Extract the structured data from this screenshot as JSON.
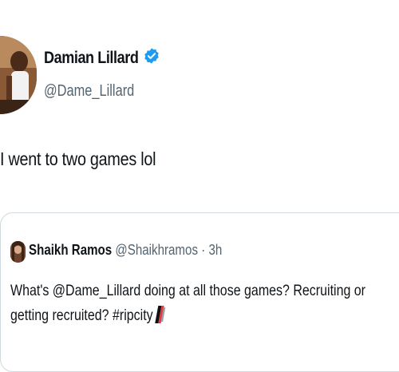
{
  "tweet": {
    "author": {
      "display_name": "Damian Lillard",
      "handle": "@Dame_Lillard",
      "verified": true
    },
    "text": "I went to two games lol"
  },
  "quoted_tweet": {
    "author": {
      "display_name": "Shaikh Ramos",
      "handle": "@Shaikhramos",
      "separator": "·",
      "time_ago": "3h"
    },
    "text_main": "What's @Dame_Lillard doing at all those games? Recruiting or getting recruited?",
    "hashtag": "#ripcity"
  },
  "colors": {
    "text": "#0f1419",
    "secondary": "#536471",
    "verified_blue": "#1d9bf0",
    "border": "#cfd9de"
  },
  "icons": {
    "verified": "verified-badge-icon",
    "team_logo": "trail-blazers-logo-icon"
  }
}
